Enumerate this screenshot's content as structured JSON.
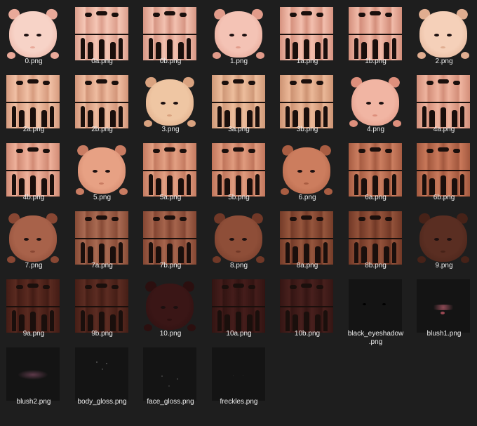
{
  "files": [
    {
      "name": "0.png",
      "kind": "face",
      "tone": "#f7d3c7",
      "shade": "#e9a999"
    },
    {
      "name": "0a.png",
      "kind": "body",
      "tone": "#f5c6b5",
      "shade": "#dc9e8c"
    },
    {
      "name": "0b.png",
      "kind": "body",
      "tone": "#f3c1b0",
      "shade": "#d69583"
    },
    {
      "name": "1.png",
      "kind": "face",
      "tone": "#f4c3b5",
      "shade": "#e19b8a"
    },
    {
      "name": "1a.png",
      "kind": "body",
      "tone": "#f3bfae",
      "shade": "#d6927f"
    },
    {
      "name": "1b.png",
      "kind": "body",
      "tone": "#f1bba9",
      "shade": "#d38e7b"
    },
    {
      "name": "2.png",
      "kind": "face",
      "tone": "#f5d0b9",
      "shade": "#e0ad90"
    },
    {
      "name": "2a.png",
      "kind": "body",
      "tone": "#f1c0a5",
      "shade": "#d69b7e"
    },
    {
      "name": "2b.png",
      "kind": "body",
      "tone": "#efbca0",
      "shade": "#d29579"
    },
    {
      "name": "3.png",
      "kind": "face",
      "tone": "#efc6a3",
      "shade": "#d9a27f"
    },
    {
      "name": "3a.png",
      "kind": "body",
      "tone": "#edbd9c",
      "shade": "#cf9878"
    },
    {
      "name": "3b.png",
      "kind": "body",
      "tone": "#ebb898",
      "shade": "#cd9373"
    },
    {
      "name": "4.png",
      "kind": "face",
      "tone": "#f1b5a3",
      "shade": "#dd8f7c"
    },
    {
      "name": "4a.png",
      "kind": "body",
      "tone": "#efb49f",
      "shade": "#d38e79"
    },
    {
      "name": "4b.png",
      "kind": "body",
      "tone": "#eeb19b",
      "shade": "#d18a74"
    },
    {
      "name": "5.png",
      "kind": "face",
      "tone": "#e7a184",
      "shade": "#c97c62"
    },
    {
      "name": "5a.png",
      "kind": "body",
      "tone": "#e3a083",
      "shade": "#c47a60"
    },
    {
      "name": "5b.png",
      "kind": "body",
      "tone": "#e09b7e",
      "shade": "#c0755b"
    },
    {
      "name": "6.png",
      "kind": "face",
      "tone": "#cc7d5e",
      "shade": "#a95d42"
    },
    {
      "name": "6a.png",
      "kind": "body",
      "tone": "#cb7e60",
      "shade": "#a65c42"
    },
    {
      "name": "6b.png",
      "kind": "body",
      "tone": "#c9795b",
      "shade": "#a2583e"
    },
    {
      "name": "7.png",
      "kind": "face",
      "tone": "#a8624a",
      "shade": "#884733"
    },
    {
      "name": "7a.png",
      "kind": "body",
      "tone": "#a96a52",
      "shade": "#874b36"
    },
    {
      "name": "7b.png",
      "kind": "body",
      "tone": "#a6654d",
      "shade": "#834632"
    },
    {
      "name": "8.png",
      "kind": "face",
      "tone": "#8e4e38",
      "shade": "#703827"
    },
    {
      "name": "8a.png",
      "kind": "body",
      "tone": "#96563d",
      "shade": "#743b28"
    },
    {
      "name": "8b.png",
      "kind": "body",
      "tone": "#93523a",
      "shade": "#713826"
    },
    {
      "name": "9.png",
      "kind": "face",
      "tone": "#5a2e22",
      "shade": "#462218"
    },
    {
      "name": "9a.png",
      "kind": "body",
      "tone": "#5a2a20",
      "shade": "#431c15"
    },
    {
      "name": "9b.png",
      "kind": "body",
      "tone": "#5c2c22",
      "shade": "#451e16"
    },
    {
      "name": "10.png",
      "kind": "face",
      "tone": "#3a1616",
      "shade": "#2b0f0f"
    },
    {
      "name": "10a.png",
      "kind": "body",
      "tone": "#451d1b",
      "shade": "#321412"
    },
    {
      "name": "10b.png",
      "kind": "body",
      "tone": "#48201d",
      "shade": "#341513"
    },
    {
      "name": "black_eyeshadow\n.png",
      "kind": "overlay",
      "variant": "eyeshadow"
    },
    {
      "name": "blush1.png",
      "kind": "overlay",
      "variant": "blush1"
    },
    {
      "name": "blush2.png",
      "kind": "overlay",
      "variant": "blush2"
    },
    {
      "name": "body_gloss.png",
      "kind": "overlay",
      "variant": "bodygloss"
    },
    {
      "name": "face_gloss.png",
      "kind": "overlay",
      "variant": "facegloss"
    },
    {
      "name": "freckles.png",
      "kind": "overlay",
      "variant": "freckles"
    }
  ],
  "colors": {
    "background": "#1e1e1e",
    "label": "#ececec"
  }
}
